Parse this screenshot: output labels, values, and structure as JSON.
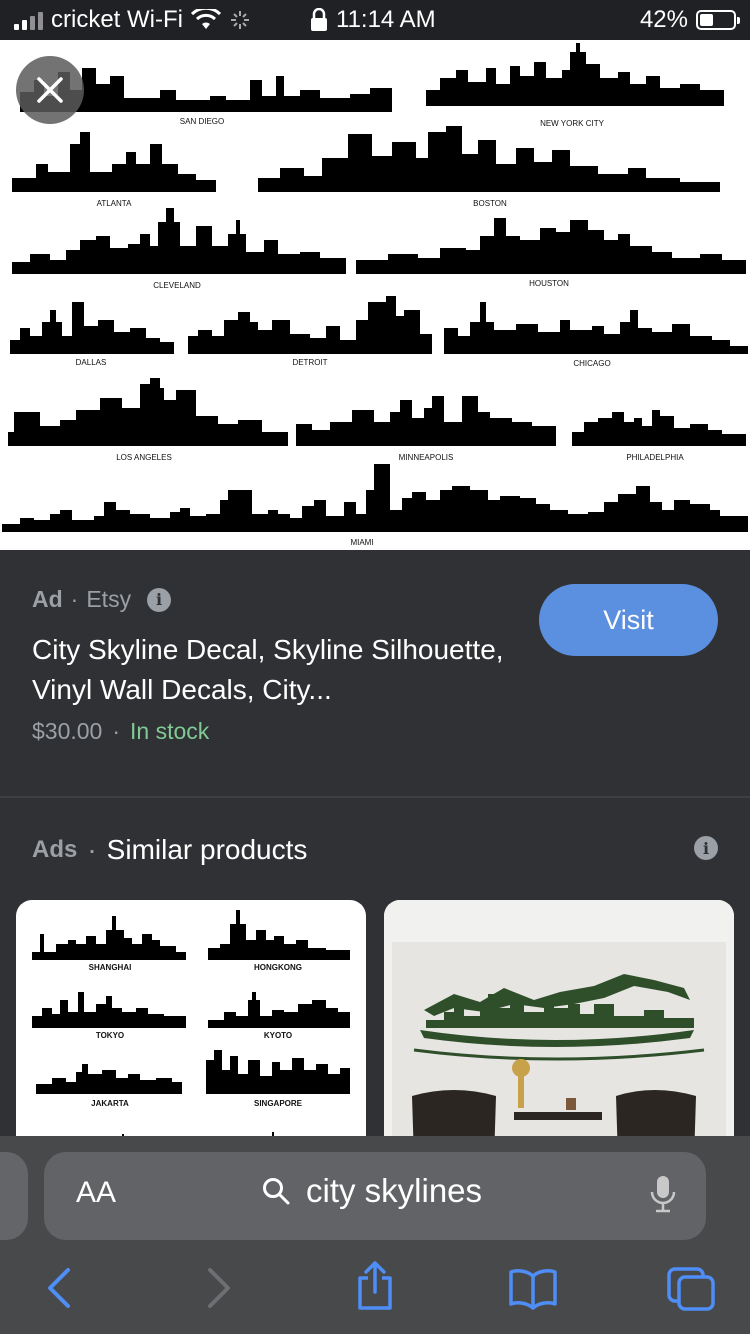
{
  "status_bar": {
    "carrier": "cricket Wi-Fi",
    "time": "11:14 AM",
    "battery_percent": "42%",
    "battery_level": 0.42
  },
  "hero_image": {
    "skyline_labels": [
      "SAN DIEGO",
      "NEW YORK CITY",
      "ATLANTA",
      "BOSTON",
      "CLEVELAND",
      "HOUSTON",
      "DALLAS",
      "DETROIT",
      "CHICAGO",
      "LOS ANGELES",
      "MINNEAPOLIS",
      "PHILADELPHIA",
      "MIAMI"
    ]
  },
  "ad": {
    "label": "Ad",
    "separator": "·",
    "seller": "Etsy",
    "title": "City Skyline Decal, Skyline Silhouette, Vinyl Wall Decals, City...",
    "price": "$30.00",
    "availability": "In stock",
    "visit_label": "Visit"
  },
  "similar": {
    "ads_label": "Ads",
    "separator": "·",
    "heading": "Similar products",
    "card1_labels": [
      "SHANGHAI",
      "HONGKONG",
      "TOKYO",
      "KYOTO",
      "JAKARTA",
      "SINGAPORE"
    ]
  },
  "browser": {
    "aa_label": "AA",
    "search_text": "city skylines"
  },
  "colors": {
    "accent": "#5b8fe0",
    "in_stock": "#81c995",
    "toolbar_blue": "#4f8ef7"
  }
}
